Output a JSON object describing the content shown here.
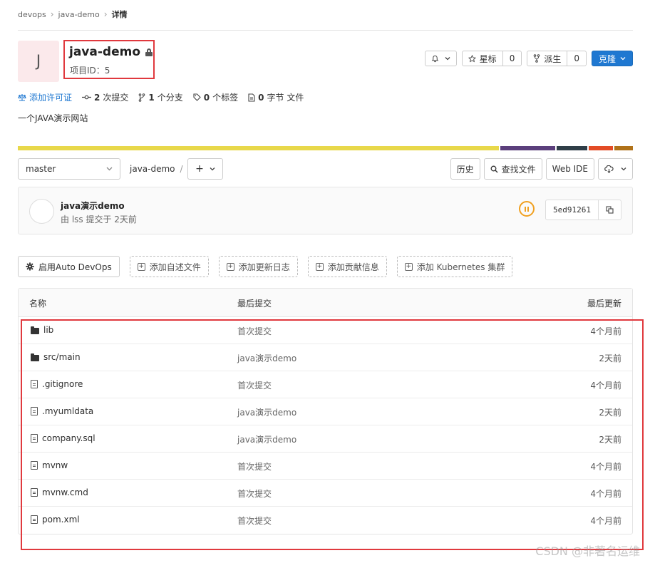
{
  "breadcrumb": {
    "items": [
      "devops",
      "java-demo"
    ],
    "current": "详情"
  },
  "project": {
    "avatar_letter": "J",
    "name": "java-demo",
    "id_label": "项目ID：",
    "id_value": "5",
    "description": "一个JAVA演示网站"
  },
  "header_actions": {
    "notification_icon": "bell-icon",
    "star_label": "星标",
    "star_count": "0",
    "fork_label": "派生",
    "fork_count": "0",
    "clone_label": "克隆"
  },
  "stats": {
    "license_label": "添加许可证",
    "commits_count": "2",
    "commits_label": "次提交",
    "branches_count": "1",
    "branches_label": "个分支",
    "tags_count": "0",
    "tags_label": "个标签",
    "size_count": "0",
    "size_label": "字节 文件"
  },
  "language_bar": {
    "colors": [
      "#e8d84a",
      "#5b3f7c",
      "#2f3e48",
      "#e34c26",
      "#b07219"
    ],
    "shares": [
      0.79,
      0.09,
      0.05,
      0.04,
      0.03
    ]
  },
  "toolbar": {
    "branch": "master",
    "path": "java-demo",
    "history_label": "历史",
    "find_file_label": "查找文件",
    "web_ide_label": "Web IDE"
  },
  "last_commit": {
    "message": "java演示demo",
    "by_label": "由 lss 提交于 2天前",
    "sha": "5ed91261",
    "pipeline_status": "paused"
  },
  "shortcuts": {
    "auto_devops": "启用Auto DevOps",
    "add_readme": "添加自述文件",
    "add_changelog": "添加更新日志",
    "add_contributing": "添加贡献信息",
    "add_kubernetes": "添加 Kubernetes 集群"
  },
  "file_table": {
    "headers": {
      "name": "名称",
      "last_commit": "最后提交",
      "last_update": "最后更新"
    },
    "rows": [
      {
        "name": "lib",
        "type": "folder",
        "commit": "首次提交",
        "updated": "4个月前"
      },
      {
        "name": "src/main",
        "type": "folder",
        "commit": "java演示demo",
        "updated": "2天前"
      },
      {
        "name": ".gitignore",
        "type": "file",
        "commit": "首次提交",
        "updated": "4个月前"
      },
      {
        "name": ".myumldata",
        "type": "file",
        "commit": "java演示demo",
        "updated": "2天前"
      },
      {
        "name": "company.sql",
        "type": "file",
        "commit": "java演示demo",
        "updated": "2天前"
      },
      {
        "name": "mvnw",
        "type": "file",
        "commit": "首次提交",
        "updated": "4个月前"
      },
      {
        "name": "mvnw.cmd",
        "type": "file",
        "commit": "首次提交",
        "updated": "4个月前"
      },
      {
        "name": "pom.xml",
        "type": "file",
        "commit": "首次提交",
        "updated": "4个月前"
      }
    ]
  },
  "watermark": "CSDN @非著名运维"
}
